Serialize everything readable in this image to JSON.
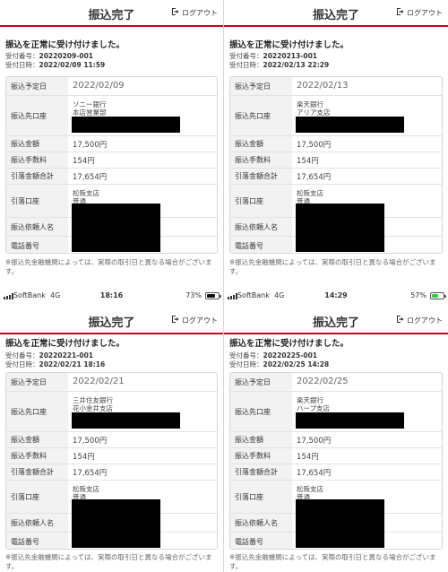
{
  "panels": [
    {
      "header": {
        "title": "振込完了",
        "logout": "ログアウト"
      },
      "message": "振込を正常に受け付けました。",
      "receipt_number_label": "受付番号：",
      "receipt_number": "20220209-001",
      "receipt_datetime_label": "受付日時：",
      "receipt_datetime": "2022/02/09 11:59",
      "rows": {
        "scheduled_date": {
          "label": "振込予定日",
          "value": "2022/02/09"
        },
        "dest_account": {
          "label": "振込先口座",
          "line1": "ソニー銀行",
          "line2": "本店営業部"
        },
        "amount": {
          "label": "振込金額",
          "value": "17,500円"
        },
        "fee": {
          "label": "振込手数料",
          "value": "154円"
        },
        "total": {
          "label": "引落金額合計",
          "value": "17,654円"
        },
        "debit_account": {
          "label": "引落口座",
          "line1": "松阪支店",
          "line2": "普通"
        },
        "requester": {
          "label": "振込依頼人名"
        },
        "phone": {
          "label": "電話番号"
        }
      },
      "note": "※振込先金融機関によっては、実際の取引日と異なる場合がございます。",
      "status_bar": {
        "carrier": "SoftBank",
        "network": "4G",
        "time": "18:16",
        "battery": "73%",
        "battery_level": 0.73
      }
    },
    {
      "header": {
        "title": "振込完了",
        "logout": "ログアウト"
      },
      "message": "振込を正常に受け付けました。",
      "receipt_number_label": "受付番号：",
      "receipt_number": "20220213-001",
      "receipt_datetime_label": "受付日時：",
      "receipt_datetime": "2022/02/13 22:29",
      "rows": {
        "scheduled_date": {
          "label": "振込予定日",
          "value": "2022/02/13"
        },
        "dest_account": {
          "label": "振込先口座",
          "line1": "楽天銀行",
          "line2": "アリア支店"
        },
        "amount": {
          "label": "振込金額",
          "value": "17,500円"
        },
        "fee": {
          "label": "振込手数料",
          "value": "154円"
        },
        "total": {
          "label": "引落金額合計",
          "value": "17,654円"
        },
        "debit_account": {
          "label": "引落口座",
          "line1": "松阪支店",
          "line2": "普通"
        },
        "requester": {
          "label": "振込依頼人名"
        },
        "phone": {
          "label": "電話番号"
        }
      },
      "note": "※振込先金融機関によっては、実際の取引日と異なる場合がございます。",
      "status_bar": {
        "carrier": "SoftBank",
        "network": "4G",
        "time": "14:29",
        "battery": "57%",
        "battery_level": 0.57
      }
    },
    {
      "header": {
        "title": "振込完了",
        "logout": "ログアウト"
      },
      "message": "振込を正常に受け付けました。",
      "receipt_number_label": "受付番号：",
      "receipt_number": "20220221-001",
      "receipt_datetime_label": "受付日時：",
      "receipt_datetime": "2022/02/21 18:16",
      "rows": {
        "scheduled_date": {
          "label": "振込予定日",
          "value": "2022/02/21"
        },
        "dest_account": {
          "label": "振込先口座",
          "line1": "三井住友銀行",
          "line2": "花小金井支店"
        },
        "amount": {
          "label": "振込金額",
          "value": "17,500円"
        },
        "fee": {
          "label": "振込手数料",
          "value": "154円"
        },
        "total": {
          "label": "引落金額合計",
          "value": "17,654円"
        },
        "debit_account": {
          "label": "引落口座",
          "line1": "松阪支店",
          "line2": "普通"
        },
        "requester": {
          "label": "振込依頼人名"
        },
        "phone": {
          "label": "電話番号"
        }
      },
      "note": "※振込先金融機関によっては、実際の取引日と異なる場合がございます。"
    },
    {
      "header": {
        "title": "振込完了",
        "logout": "ログアウト"
      },
      "message": "振込を正常に受け付けました。",
      "receipt_number_label": "受付番号：",
      "receipt_number": "20220225-001",
      "receipt_datetime_label": "受付日時：",
      "receipt_datetime": "2022/02/25 14:28",
      "rows": {
        "scheduled_date": {
          "label": "振込予定日",
          "value": "2022/02/25"
        },
        "dest_account": {
          "label": "振込先口座",
          "line1": "楽天銀行",
          "line2": "ハープ支店"
        },
        "amount": {
          "label": "振込金額",
          "value": "17,500円"
        },
        "fee": {
          "label": "振込手数料",
          "value": "154円"
        },
        "total": {
          "label": "引落金額合計",
          "value": "17,654円"
        },
        "debit_account": {
          "label": "引落口座",
          "line1": "松阪支店",
          "line2": "普通"
        },
        "requester": {
          "label": "振込依頼人名"
        },
        "phone": {
          "label": "電話番号"
        }
      },
      "note": "※振込先金融機関によっては、実際の取引日と異なる場合がございます。"
    }
  ]
}
